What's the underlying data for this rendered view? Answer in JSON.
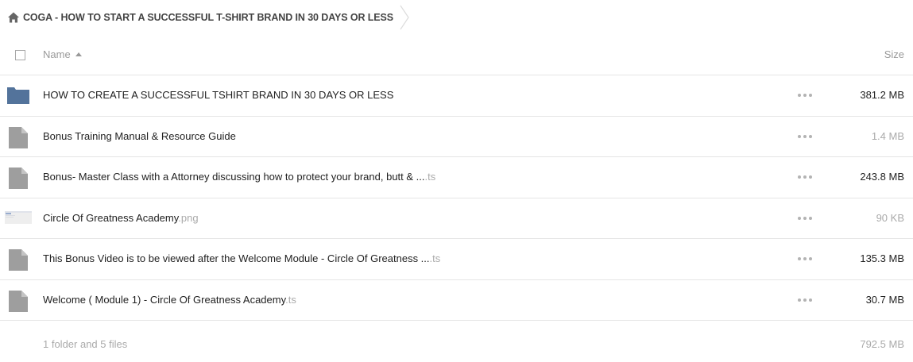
{
  "breadcrumb": {
    "icon": "home-icon",
    "label": "COGA - HOW TO START A SUCCESSFUL T-SHIRT BRAND IN 30 DAYS OR LESS"
  },
  "header": {
    "name_label": "Name",
    "size_label": "Size",
    "sort_direction": "ascending"
  },
  "colors": {
    "folder": "#53739b",
    "file": "#9e9e9e",
    "divider": "#e5e5e5",
    "muted_text": "#aaaaaa"
  },
  "rows": [
    {
      "type": "folder",
      "icon": "folder-icon",
      "name": "HOW TO CREATE A SUCCESSFUL TSHIRT BRAND IN 30 DAYS OR LESS",
      "ext": "",
      "size": "381.2 MB",
      "size_dim": false
    },
    {
      "type": "file",
      "icon": "file-icon",
      "name": "Bonus Training Manual & Resource Guide",
      "ext": "",
      "size": "1.4 MB",
      "size_dim": true
    },
    {
      "type": "file",
      "icon": "file-icon",
      "name": "Bonus- Master Class with a Attorney discussing how to protect your brand, butt & ...",
      "ext": ".ts",
      "size": "243.8 MB",
      "size_dim": false
    },
    {
      "type": "image",
      "icon": "image-thumbnail-icon",
      "name": "Circle Of Greatness Academy",
      "ext": ".png",
      "size": "90 KB",
      "size_dim": true
    },
    {
      "type": "file",
      "icon": "file-icon",
      "name": "This Bonus Video is to be viewed after the Welcome Module - Circle Of Greatness ...",
      "ext": ".ts",
      "size": "135.3 MB",
      "size_dim": false
    },
    {
      "type": "file",
      "icon": "file-icon",
      "name": "Welcome ( Module 1) - Circle Of Greatness Academy",
      "ext": ".ts",
      "size": "30.7 MB",
      "size_dim": false
    }
  ],
  "footer": {
    "summary": "1 folder and 5 files",
    "total": "792.5 MB"
  }
}
